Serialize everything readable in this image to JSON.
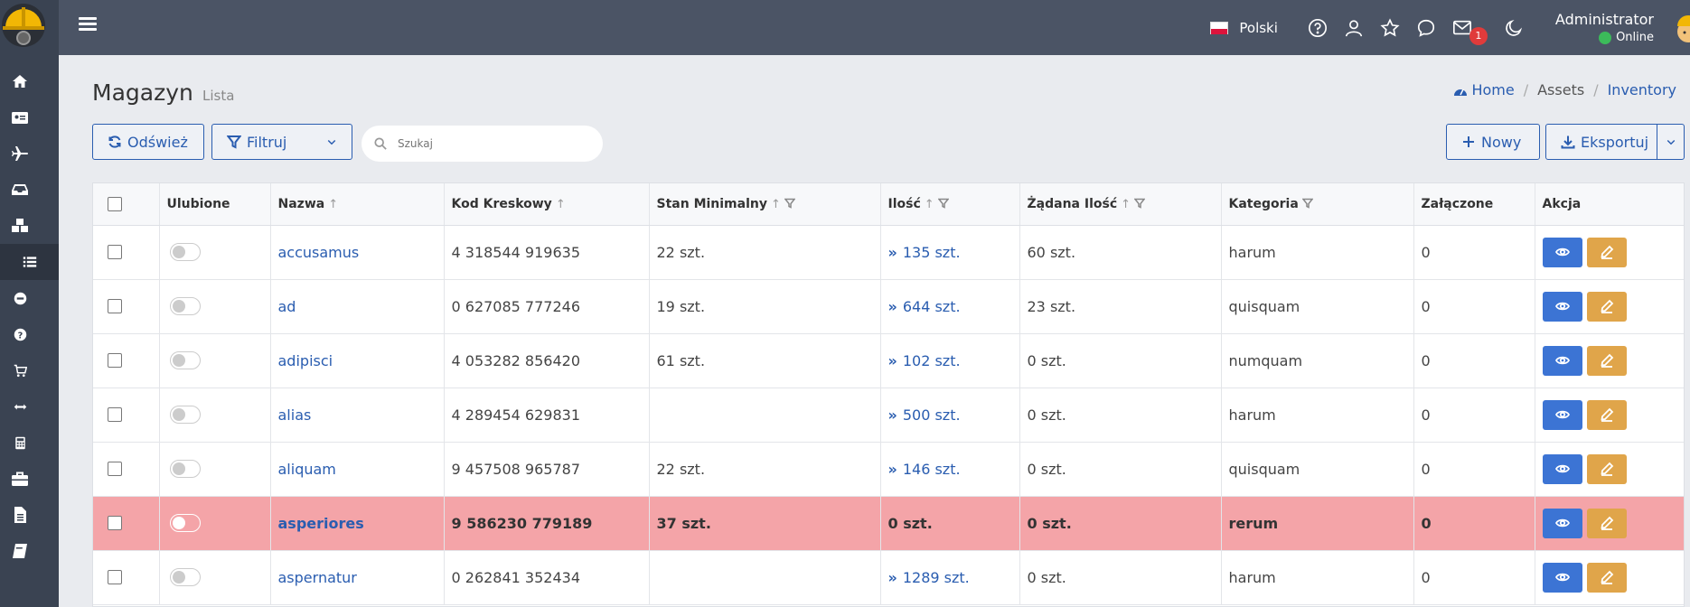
{
  "topbar": {
    "language": "Polski",
    "mail_badge": "1",
    "user_name": "Administrator",
    "user_status": "Online"
  },
  "page": {
    "title": "Magazyn",
    "subtitle": "Lista"
  },
  "breadcrumb": {
    "home": "Home",
    "assets": "Assets",
    "inventory": "Inventory"
  },
  "toolbar": {
    "refresh": "Odśwież",
    "filter": "Filtruj",
    "search_placeholder": "Szukaj",
    "new": "Nowy",
    "export": "Eksportuj"
  },
  "table": {
    "headers": {
      "favorite": "Ulubione",
      "name": "Nazwa",
      "barcode": "Kod Kreskowy",
      "min_stock": "Stan Minimalny",
      "quantity": "Ilość",
      "requested": "Żądana Ilość",
      "category": "Kategoria",
      "attached": "Załączone",
      "action": "Akcja"
    },
    "rows": [
      {
        "name": "accusamus",
        "barcode": "4 318544 919635",
        "min_stock": "22 szt.",
        "quantity": "135 szt.",
        "requested": "60 szt.",
        "category": "harum",
        "attached": "0"
      },
      {
        "name": "ad",
        "barcode": "0 627085 777246",
        "min_stock": "19 szt.",
        "quantity": "644 szt.",
        "requested": "23 szt.",
        "category": "quisquam",
        "attached": "0"
      },
      {
        "name": "adipisci",
        "barcode": "4 053282 856420",
        "min_stock": "61 szt.",
        "quantity": "102 szt.",
        "requested": "0 szt.",
        "category": "numquam",
        "attached": "0"
      },
      {
        "name": "alias",
        "barcode": "4 289454 629831",
        "min_stock": "",
        "quantity": "500 szt.",
        "requested": "0 szt.",
        "category": "harum",
        "attached": "0"
      },
      {
        "name": "aliquam",
        "barcode": "9 457508 965787",
        "min_stock": "22 szt.",
        "quantity": "146 szt.",
        "requested": "0 szt.",
        "category": "quisquam",
        "attached": "0"
      },
      {
        "name": "asperiores",
        "barcode": "9 586230 779189",
        "min_stock": "37 szt.",
        "quantity": "0 szt.",
        "requested": "0 szt.",
        "category": "rerum",
        "attached": "0"
      },
      {
        "name": "aspernatur",
        "barcode": "0 262841 352434",
        "min_stock": "",
        "quantity": "1289 szt.",
        "requested": "0 szt.",
        "category": "harum",
        "attached": "0"
      }
    ]
  },
  "colors": {
    "sidebar": "#3a4352",
    "topbar": "#4b5465",
    "accent": "#2a5db0",
    "alert_row": "#f4a4a8",
    "view_button": "#3c74d4",
    "edit_button": "#e0a54a"
  }
}
